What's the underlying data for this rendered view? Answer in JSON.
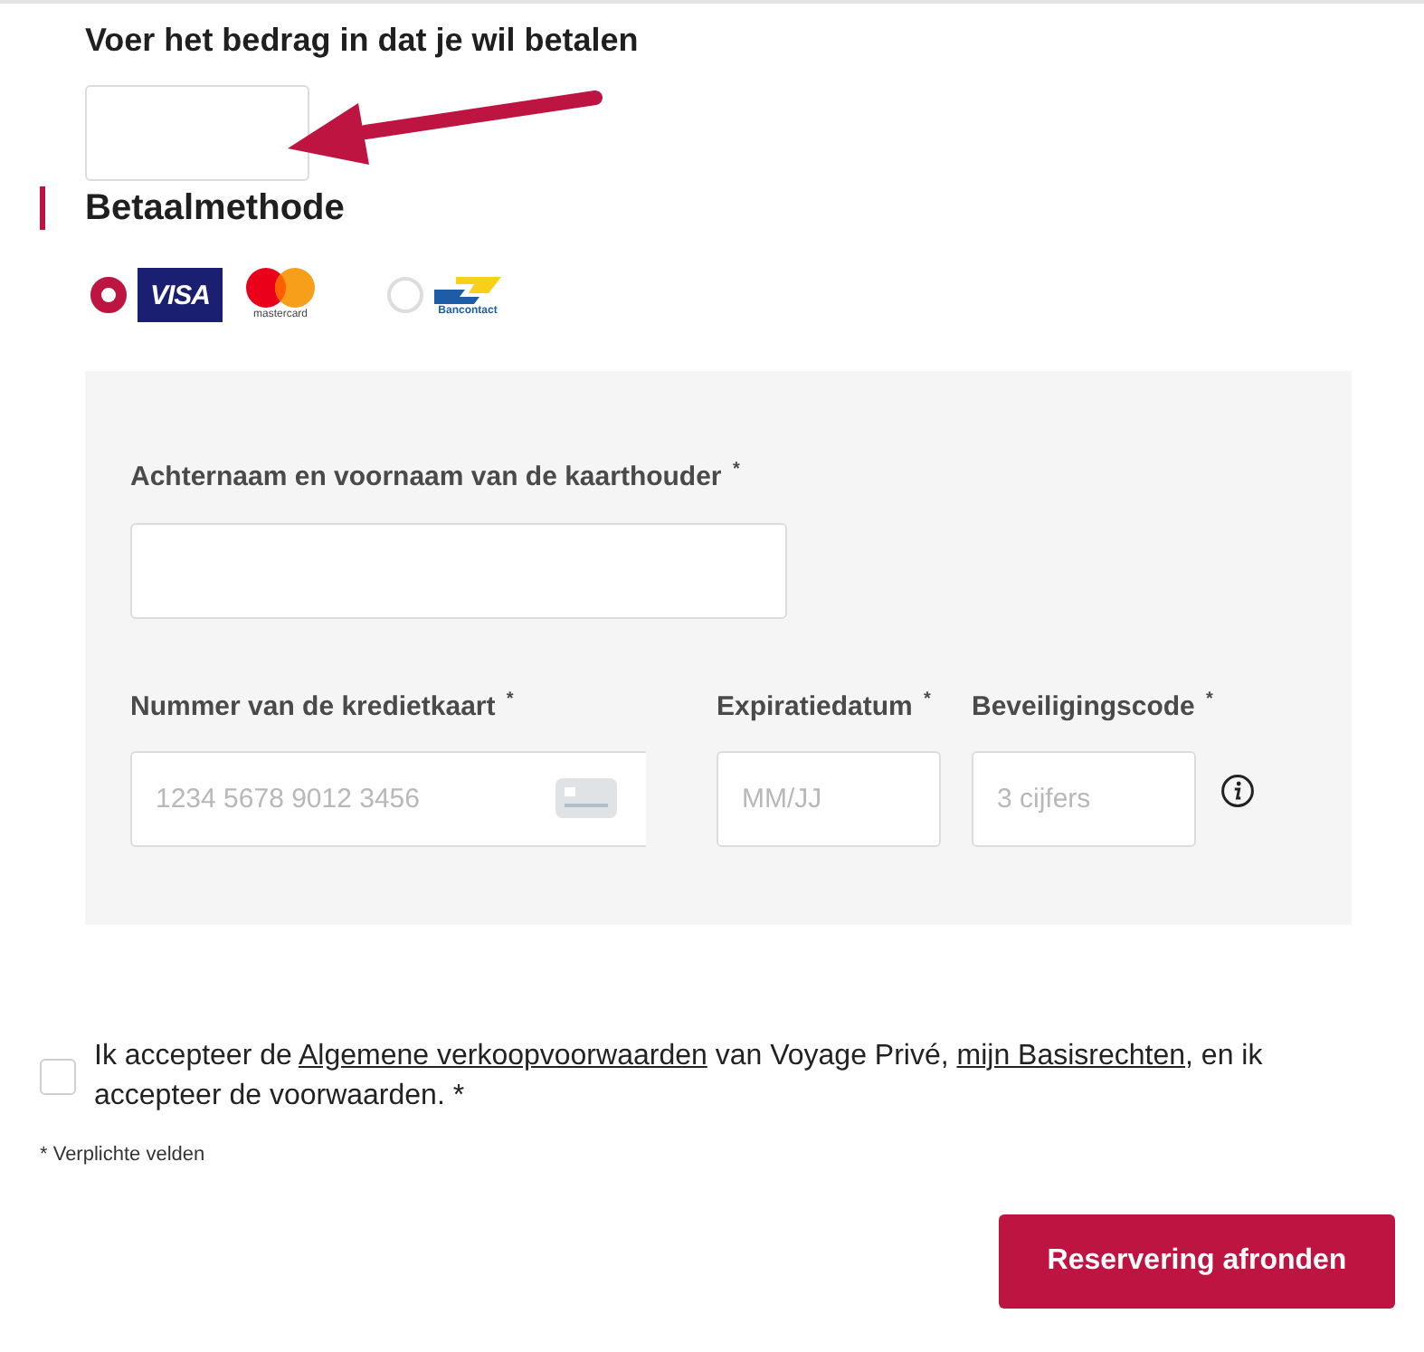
{
  "amount": {
    "heading": "Voer het bedrag in dat je wil betalen"
  },
  "payment": {
    "title": "Betaalmethode",
    "options": [
      {
        "selected": true,
        "logos": [
          {
            "kind": "visa",
            "text": "VISA"
          },
          {
            "kind": "mastercard",
            "text": "mastercard"
          }
        ]
      },
      {
        "selected": false,
        "logos": [
          {
            "kind": "bancontact",
            "text": "Bancontact"
          }
        ]
      }
    ]
  },
  "card_form": {
    "rows": [
      [
        {
          "kind": "name",
          "label": "Achternaam en voornaam van de kaarthouder $^{*}$"
        }
      ],
      [
        {
          "kind": "card_number",
          "label": "Nummer van de kredietkaart $^{*}$",
          "placeholder": "1234 5678 9012 3456"
        },
        {
          "kind": "expiry",
          "label": "Expiratiedatum $^{*}$",
          "placeholder": "MM/JJ"
        },
        {
          "kind": "security_code",
          "label": "Beveiligingscode $^{*}$",
          "placeholder": "3 cijfers"
        }
      ]
    ]
  },
  "consent": {
    "checked": false,
    "parts": [
      {
        "kind": "text",
        "text": "Ik accepteer de "
      },
      {
        "kind": "link",
        "text": "Algemene verkoopvoorwaarden"
      },
      {
        "kind": "text",
        "text": " van Voyage Privé, "
      },
      {
        "kind": "link",
        "text": "mijn Basisrechten"
      },
      {
        "kind": "text",
        "text": ", en ik accepteer de voorwaarden. *"
      }
    ]
  },
  "footnote": "* Verplichte velden",
  "submit_button": "Reservering afronden"
}
